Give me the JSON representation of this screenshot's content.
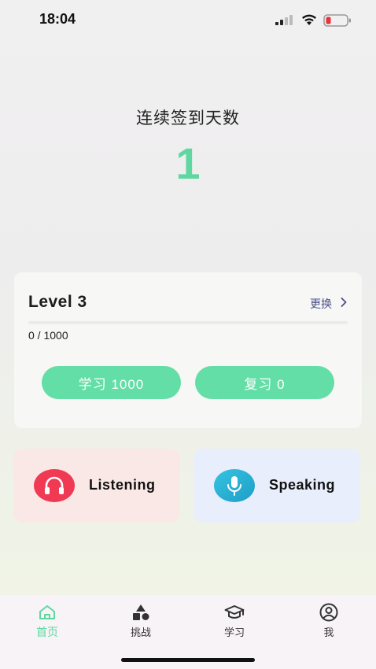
{
  "status_bar": {
    "time": "18:04"
  },
  "checkin": {
    "title": "连续签到天数",
    "count": "1"
  },
  "level_card": {
    "level": "Level 3",
    "change_label": "更换",
    "progress_text": "0 / 1000",
    "progress_fraction": 0,
    "study_button": "学习 1000",
    "review_button": "复习 0"
  },
  "skills": {
    "listening": {
      "label": "Listening",
      "icon": "headphones-icon",
      "color": "#f03a54"
    },
    "speaking": {
      "label": "Speaking",
      "icon": "microphone-icon",
      "color": "#2ab0d6"
    }
  },
  "tab_bar": {
    "items": [
      {
        "label": "首页",
        "icon": "home-icon",
        "active": true
      },
      {
        "label": "挑战",
        "icon": "shapes-icon",
        "active": false
      },
      {
        "label": "学习",
        "icon": "graduation-cap-icon",
        "active": false
      },
      {
        "label": "我",
        "icon": "user-circle-icon",
        "active": false
      }
    ]
  },
  "colors": {
    "accent": "#5ed8a0",
    "button": "#63dea6"
  }
}
